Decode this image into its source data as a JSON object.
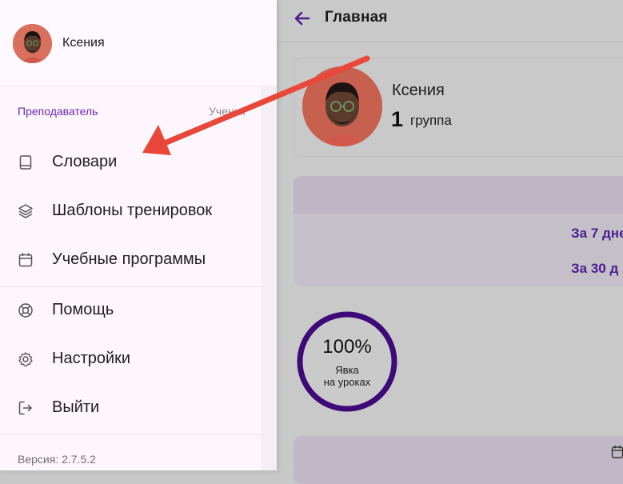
{
  "header": {
    "title": "Главная"
  },
  "profile": {
    "name": "Ксения",
    "group_number": "1",
    "group_label": "группа"
  },
  "stats": {
    "period_7": "За 7 дне",
    "period_30": "За 30 д"
  },
  "attendance": {
    "percent": 100,
    "value": "100%",
    "label_line1": "Явка",
    "label_line2": "на уроках"
  },
  "drawer": {
    "user_name": "Ксения",
    "roles": {
      "teacher": "Преподаватель",
      "student": "Ученик"
    },
    "menu": [
      {
        "label": "Словари",
        "icon": "book-icon"
      },
      {
        "label": "Шаблоны тренировок",
        "icon": "layers-icon"
      },
      {
        "label": "Учебные программы",
        "icon": "calendar-icon"
      },
      {
        "label": "Помощь",
        "icon": "lifebuoy-icon"
      },
      {
        "label": "Настройки",
        "icon": "gear-icon"
      },
      {
        "label": "Выйти",
        "icon": "logout-icon"
      }
    ],
    "version": "Версия: 2.7.5.2"
  },
  "colors": {
    "accent": "#6a2bb4",
    "ring": "#3d0a78",
    "annotation_arrow": "#e8473a",
    "drawer_bg": "#fdf6fd",
    "overlay_bg": "#c9c9c9"
  }
}
